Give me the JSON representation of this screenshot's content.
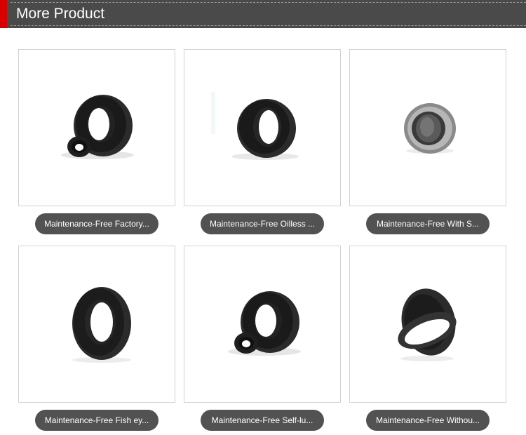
{
  "header": {
    "title": "More Product"
  },
  "products": [
    {
      "label": "Maintenance-Free Factory...",
      "image": "black-bearing-with-small-ring"
    },
    {
      "label": "Maintenance-Free Oilless ...",
      "image": "black-bearing"
    },
    {
      "label": "Maintenance-Free With S...",
      "image": "silver-bearing"
    },
    {
      "label": "Maintenance-Free Fish ey...",
      "image": "black-ring-bearing"
    },
    {
      "label": "Maintenance-Free Self-lu...",
      "image": "black-bearing-with-small-ring"
    },
    {
      "label": "Maintenance-Free Withou...",
      "image": "tilted-black-bearing"
    }
  ],
  "colors": {
    "accent": "#d90000",
    "header_bg": "#4a4a4a",
    "pill_bg": "#525252"
  }
}
